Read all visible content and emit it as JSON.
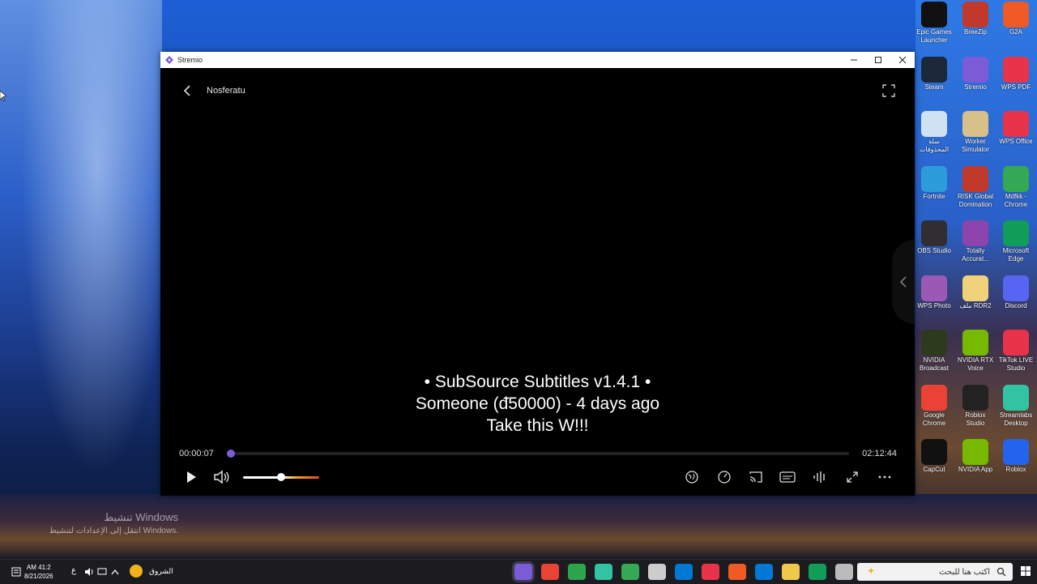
{
  "window": {
    "app_title": "Stremio",
    "movie_title": "Nosferatu",
    "subtitles": [
      "• SubSource Subtitles v1.4.1 •",
      "Someone (ᵭ50000) - 4 days ago",
      "Take this W!!!"
    ],
    "time_elapsed": "00:00:07",
    "time_total": "02:12:44",
    "progress": 0.001,
    "volume": 0.5,
    "accent_color": "#7b5bd6"
  },
  "watermark": {
    "line1": "تنشيط Windows",
    "line2": "انتقل إلى الإعدادات لتنشيط Windows."
  },
  "desktop_icons": [
    {
      "label": "Epic Games Launcher",
      "icon": "epic-games-icon",
      "color": "#111"
    },
    {
      "label": "BreeZip",
      "icon": "breezip-icon",
      "color": "#c0392b"
    },
    {
      "label": "G2A",
      "icon": "g2a-icon",
      "color": "#f05a24"
    },
    {
      "label": "Steam",
      "icon": "steam-icon",
      "color": "#1b2838"
    },
    {
      "label": "Stremio",
      "icon": "stremio-icon",
      "color": "#7b5bd6"
    },
    {
      "label": "WPS PDF",
      "icon": "wps-pdf-icon",
      "color": "#e8334a"
    },
    {
      "label": "سلة المحذوفات",
      "icon": "recycle-bin-icon",
      "color": "#cfe2f3"
    },
    {
      "label": "Worker Simulator",
      "icon": "worker-simulator-icon",
      "color": "#d8c089"
    },
    {
      "label": "WPS Office",
      "icon": "wps-office-icon",
      "color": "#e8334a"
    },
    {
      "label": "Fortnite",
      "icon": "fortnite-icon",
      "color": "#2d9cdb"
    },
    {
      "label": "RISK Global Domination",
      "icon": "risk-icon",
      "color": "#c0392b"
    },
    {
      "label": "Mdfkk - Chrome",
      "icon": "chrome-profile-icon",
      "color": "#34a853"
    },
    {
      "label": "OBS Studio",
      "icon": "obs-icon",
      "color": "#302e31"
    },
    {
      "label": "Totally Accurat...",
      "icon": "tabs-game-icon",
      "color": "#8e44ad"
    },
    {
      "label": "Microsoft Edge",
      "icon": "edge-icon",
      "color": "#0f9d58"
    },
    {
      "label": "WPS Photo",
      "icon": "wps-photo-icon",
      "color": "#9b59b6"
    },
    {
      "label": "ملف RDR2",
      "icon": "folder-icon",
      "color": "#f0d27a"
    },
    {
      "label": "Discord",
      "icon": "discord-icon",
      "color": "#5865f2"
    },
    {
      "label": "NVIDIA Broadcast",
      "icon": "nvidia-broadcast-icon",
      "color": "#2d3a1e"
    },
    {
      "label": "NVIDIA RTX Voice",
      "icon": "nvidia-rtx-voice-icon",
      "color": "#76b900"
    },
    {
      "label": "TikTok LIVE Studio",
      "icon": "tiktok-icon",
      "color": "#e8334a"
    },
    {
      "label": "Google Chrome",
      "icon": "chrome-icon",
      "color": "#ea4335"
    },
    {
      "label": "Roblox Studio",
      "icon": "roblox-studio-icon",
      "color": "#222"
    },
    {
      "label": "Streamlabs Desktop",
      "icon": "streamlabs-icon",
      "color": "#31c3a2"
    },
    {
      "label": "CapCut",
      "icon": "capcut-icon",
      "color": "#111"
    },
    {
      "label": "NVIDIA App",
      "icon": "nvidia-app-icon",
      "color": "#76b900"
    },
    {
      "label": "Roblox",
      "icon": "roblox-icon",
      "color": "#2463eb"
    }
  ],
  "taskbar": {
    "time": "AM 41:2",
    "date": "8/21/2026",
    "lang": "ع",
    "weather_label": "الشروق",
    "search_placeholder": "اكتب هنا للبحث",
    "apps": [
      {
        "icon": "stremio-taskbar-icon",
        "color": "#7b5bd6"
      },
      {
        "icon": "chrome-taskbar-icon",
        "color": "#ea4335"
      },
      {
        "icon": "gamepass-taskbar-icon",
        "color": "#2da44e"
      },
      {
        "icon": "streamlabs-taskbar-icon",
        "color": "#31c3a2"
      },
      {
        "icon": "chrome-profile-taskbar-icon",
        "color": "#34a853"
      },
      {
        "icon": "settings-taskbar-icon",
        "color": "#ccc"
      },
      {
        "icon": "store-taskbar-icon",
        "color": "#0078d4"
      },
      {
        "icon": "wps-taskbar-icon",
        "color": "#e8334a"
      },
      {
        "icon": "g2a-taskbar-icon",
        "color": "#f05a24"
      },
      {
        "icon": "mail-taskbar-icon",
        "color": "#0078d4"
      },
      {
        "icon": "explorer-taskbar-icon",
        "color": "#f0c94a"
      },
      {
        "icon": "edge-taskbar-icon",
        "color": "#0f9d58"
      },
      {
        "icon": "taskview-taskbar-icon",
        "color": "#bbb"
      }
    ]
  }
}
